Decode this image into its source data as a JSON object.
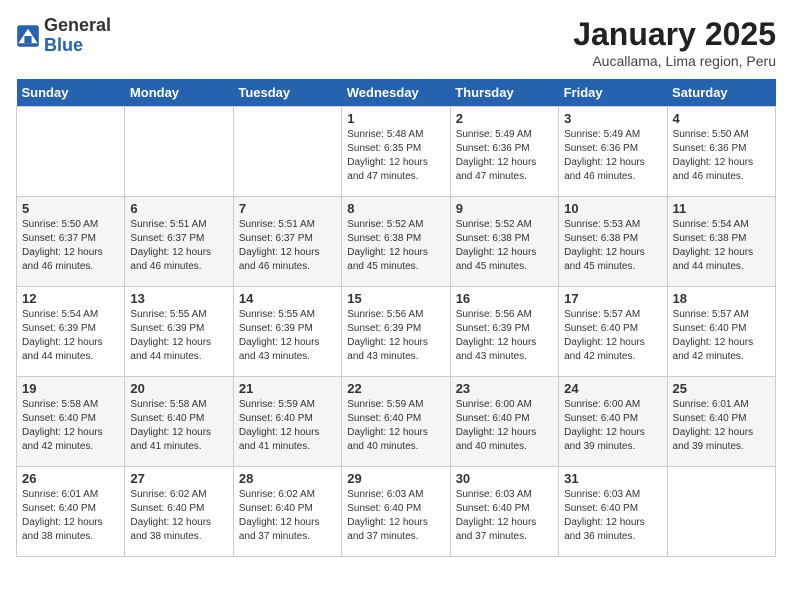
{
  "logo": {
    "general": "General",
    "blue": "Blue"
  },
  "title": "January 2025",
  "subtitle": "Aucallama, Lima region, Peru",
  "weekdays": [
    "Sunday",
    "Monday",
    "Tuesday",
    "Wednesday",
    "Thursday",
    "Friday",
    "Saturday"
  ],
  "weeks": [
    [
      {
        "day": "",
        "info": ""
      },
      {
        "day": "",
        "info": ""
      },
      {
        "day": "",
        "info": ""
      },
      {
        "day": "1",
        "info": "Sunrise: 5:48 AM\nSunset: 6:35 PM\nDaylight: 12 hours\nand 47 minutes."
      },
      {
        "day": "2",
        "info": "Sunrise: 5:49 AM\nSunset: 6:36 PM\nDaylight: 12 hours\nand 47 minutes."
      },
      {
        "day": "3",
        "info": "Sunrise: 5:49 AM\nSunset: 6:36 PM\nDaylight: 12 hours\nand 46 minutes."
      },
      {
        "day": "4",
        "info": "Sunrise: 5:50 AM\nSunset: 6:36 PM\nDaylight: 12 hours\nand 46 minutes."
      }
    ],
    [
      {
        "day": "5",
        "info": "Sunrise: 5:50 AM\nSunset: 6:37 PM\nDaylight: 12 hours\nand 46 minutes."
      },
      {
        "day": "6",
        "info": "Sunrise: 5:51 AM\nSunset: 6:37 PM\nDaylight: 12 hours\nand 46 minutes."
      },
      {
        "day": "7",
        "info": "Sunrise: 5:51 AM\nSunset: 6:37 PM\nDaylight: 12 hours\nand 46 minutes."
      },
      {
        "day": "8",
        "info": "Sunrise: 5:52 AM\nSunset: 6:38 PM\nDaylight: 12 hours\nand 45 minutes."
      },
      {
        "day": "9",
        "info": "Sunrise: 5:52 AM\nSunset: 6:38 PM\nDaylight: 12 hours\nand 45 minutes."
      },
      {
        "day": "10",
        "info": "Sunrise: 5:53 AM\nSunset: 6:38 PM\nDaylight: 12 hours\nand 45 minutes."
      },
      {
        "day": "11",
        "info": "Sunrise: 5:54 AM\nSunset: 6:38 PM\nDaylight: 12 hours\nand 44 minutes."
      }
    ],
    [
      {
        "day": "12",
        "info": "Sunrise: 5:54 AM\nSunset: 6:39 PM\nDaylight: 12 hours\nand 44 minutes."
      },
      {
        "day": "13",
        "info": "Sunrise: 5:55 AM\nSunset: 6:39 PM\nDaylight: 12 hours\nand 44 minutes."
      },
      {
        "day": "14",
        "info": "Sunrise: 5:55 AM\nSunset: 6:39 PM\nDaylight: 12 hours\nand 43 minutes."
      },
      {
        "day": "15",
        "info": "Sunrise: 5:56 AM\nSunset: 6:39 PM\nDaylight: 12 hours\nand 43 minutes."
      },
      {
        "day": "16",
        "info": "Sunrise: 5:56 AM\nSunset: 6:39 PM\nDaylight: 12 hours\nand 43 minutes."
      },
      {
        "day": "17",
        "info": "Sunrise: 5:57 AM\nSunset: 6:40 PM\nDaylight: 12 hours\nand 42 minutes."
      },
      {
        "day": "18",
        "info": "Sunrise: 5:57 AM\nSunset: 6:40 PM\nDaylight: 12 hours\nand 42 minutes."
      }
    ],
    [
      {
        "day": "19",
        "info": "Sunrise: 5:58 AM\nSunset: 6:40 PM\nDaylight: 12 hours\nand 42 minutes."
      },
      {
        "day": "20",
        "info": "Sunrise: 5:58 AM\nSunset: 6:40 PM\nDaylight: 12 hours\nand 41 minutes."
      },
      {
        "day": "21",
        "info": "Sunrise: 5:59 AM\nSunset: 6:40 PM\nDaylight: 12 hours\nand 41 minutes."
      },
      {
        "day": "22",
        "info": "Sunrise: 5:59 AM\nSunset: 6:40 PM\nDaylight: 12 hours\nand 40 minutes."
      },
      {
        "day": "23",
        "info": "Sunrise: 6:00 AM\nSunset: 6:40 PM\nDaylight: 12 hours\nand 40 minutes."
      },
      {
        "day": "24",
        "info": "Sunrise: 6:00 AM\nSunset: 6:40 PM\nDaylight: 12 hours\nand 39 minutes."
      },
      {
        "day": "25",
        "info": "Sunrise: 6:01 AM\nSunset: 6:40 PM\nDaylight: 12 hours\nand 39 minutes."
      }
    ],
    [
      {
        "day": "26",
        "info": "Sunrise: 6:01 AM\nSunset: 6:40 PM\nDaylight: 12 hours\nand 38 minutes."
      },
      {
        "day": "27",
        "info": "Sunrise: 6:02 AM\nSunset: 6:40 PM\nDaylight: 12 hours\nand 38 minutes."
      },
      {
        "day": "28",
        "info": "Sunrise: 6:02 AM\nSunset: 6:40 PM\nDaylight: 12 hours\nand 37 minutes."
      },
      {
        "day": "29",
        "info": "Sunrise: 6:03 AM\nSunset: 6:40 PM\nDaylight: 12 hours\nand 37 minutes."
      },
      {
        "day": "30",
        "info": "Sunrise: 6:03 AM\nSunset: 6:40 PM\nDaylight: 12 hours\nand 37 minutes."
      },
      {
        "day": "31",
        "info": "Sunrise: 6:03 AM\nSunset: 6:40 PM\nDaylight: 12 hours\nand 36 minutes."
      },
      {
        "day": "",
        "info": ""
      }
    ]
  ]
}
